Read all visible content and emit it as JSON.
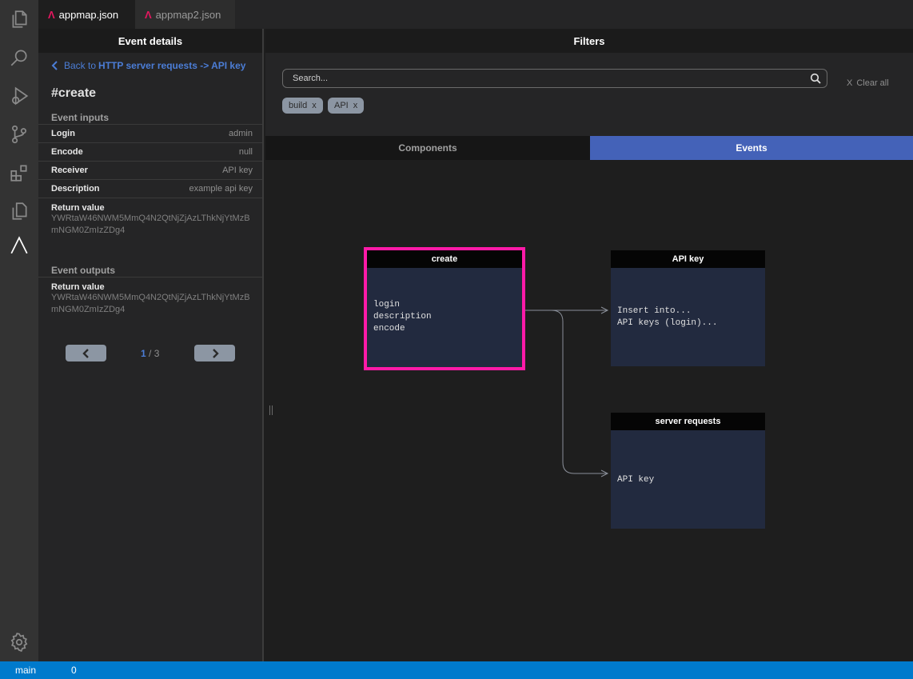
{
  "activity_bar": {
    "icons": [
      "explorer-icon",
      "search-icon",
      "run-debug-icon",
      "source-control-icon",
      "extensions-icon",
      "remote-explorer-icon",
      "appmap-icon",
      "settings-gear-icon"
    ]
  },
  "tabs": [
    {
      "label": "appmap.json",
      "active": true
    },
    {
      "label": "appmap2.json",
      "active": false
    }
  ],
  "event_details": {
    "header": "Event details",
    "back_prefix": "Back to",
    "back_target": "HTTP server requests -> API key",
    "title": "#create",
    "inputs_label": "Event inputs",
    "inputs": [
      {
        "key": "Login",
        "value": "admin"
      },
      {
        "key": "Encode",
        "value": "null"
      },
      {
        "key": "Receiver",
        "value": "API key"
      },
      {
        "key": "Description",
        "value": "example api key"
      }
    ],
    "input_return": {
      "key": "Return value",
      "value": "YWRtaW46NWM5MmQ4N2QtNjZjAzLThkNjYtMzBmNGM0ZmIzZDg4"
    },
    "outputs_label": "Event outputs",
    "output_return": {
      "key": "Return value",
      "value": "YWRtaW46NWM5MmQ4N2QtNjZjAzLThkNjYtMzBmNGM0ZmIzZDg4"
    },
    "pager": {
      "current": "1",
      "separator": "/",
      "total": "3"
    }
  },
  "filters": {
    "header": "Filters",
    "search_placeholder": "Search...",
    "clear_all_x": "X",
    "clear_all": "Clear all",
    "chips": [
      {
        "label": "build",
        "x": "x"
      },
      {
        "label": "API",
        "x": "x"
      }
    ]
  },
  "view_tabs": {
    "components": "Components",
    "events": "Events",
    "active": "Events"
  },
  "diagram": {
    "nodes": [
      {
        "title": "create",
        "lines": [
          "login",
          "description",
          "encode"
        ],
        "selected": true
      },
      {
        "title": "API key",
        "lines": [
          "Insert into...",
          "API keys (login)..."
        ]
      },
      {
        "title": "server requests",
        "lines": [
          "API key"
        ]
      }
    ],
    "colors": {
      "selection": "#ff1aa8",
      "node_body": "#222a3f",
      "node_header": "#050505",
      "accent": "#4462b8"
    }
  },
  "statusbar": {
    "branch": "main",
    "count": "0"
  }
}
